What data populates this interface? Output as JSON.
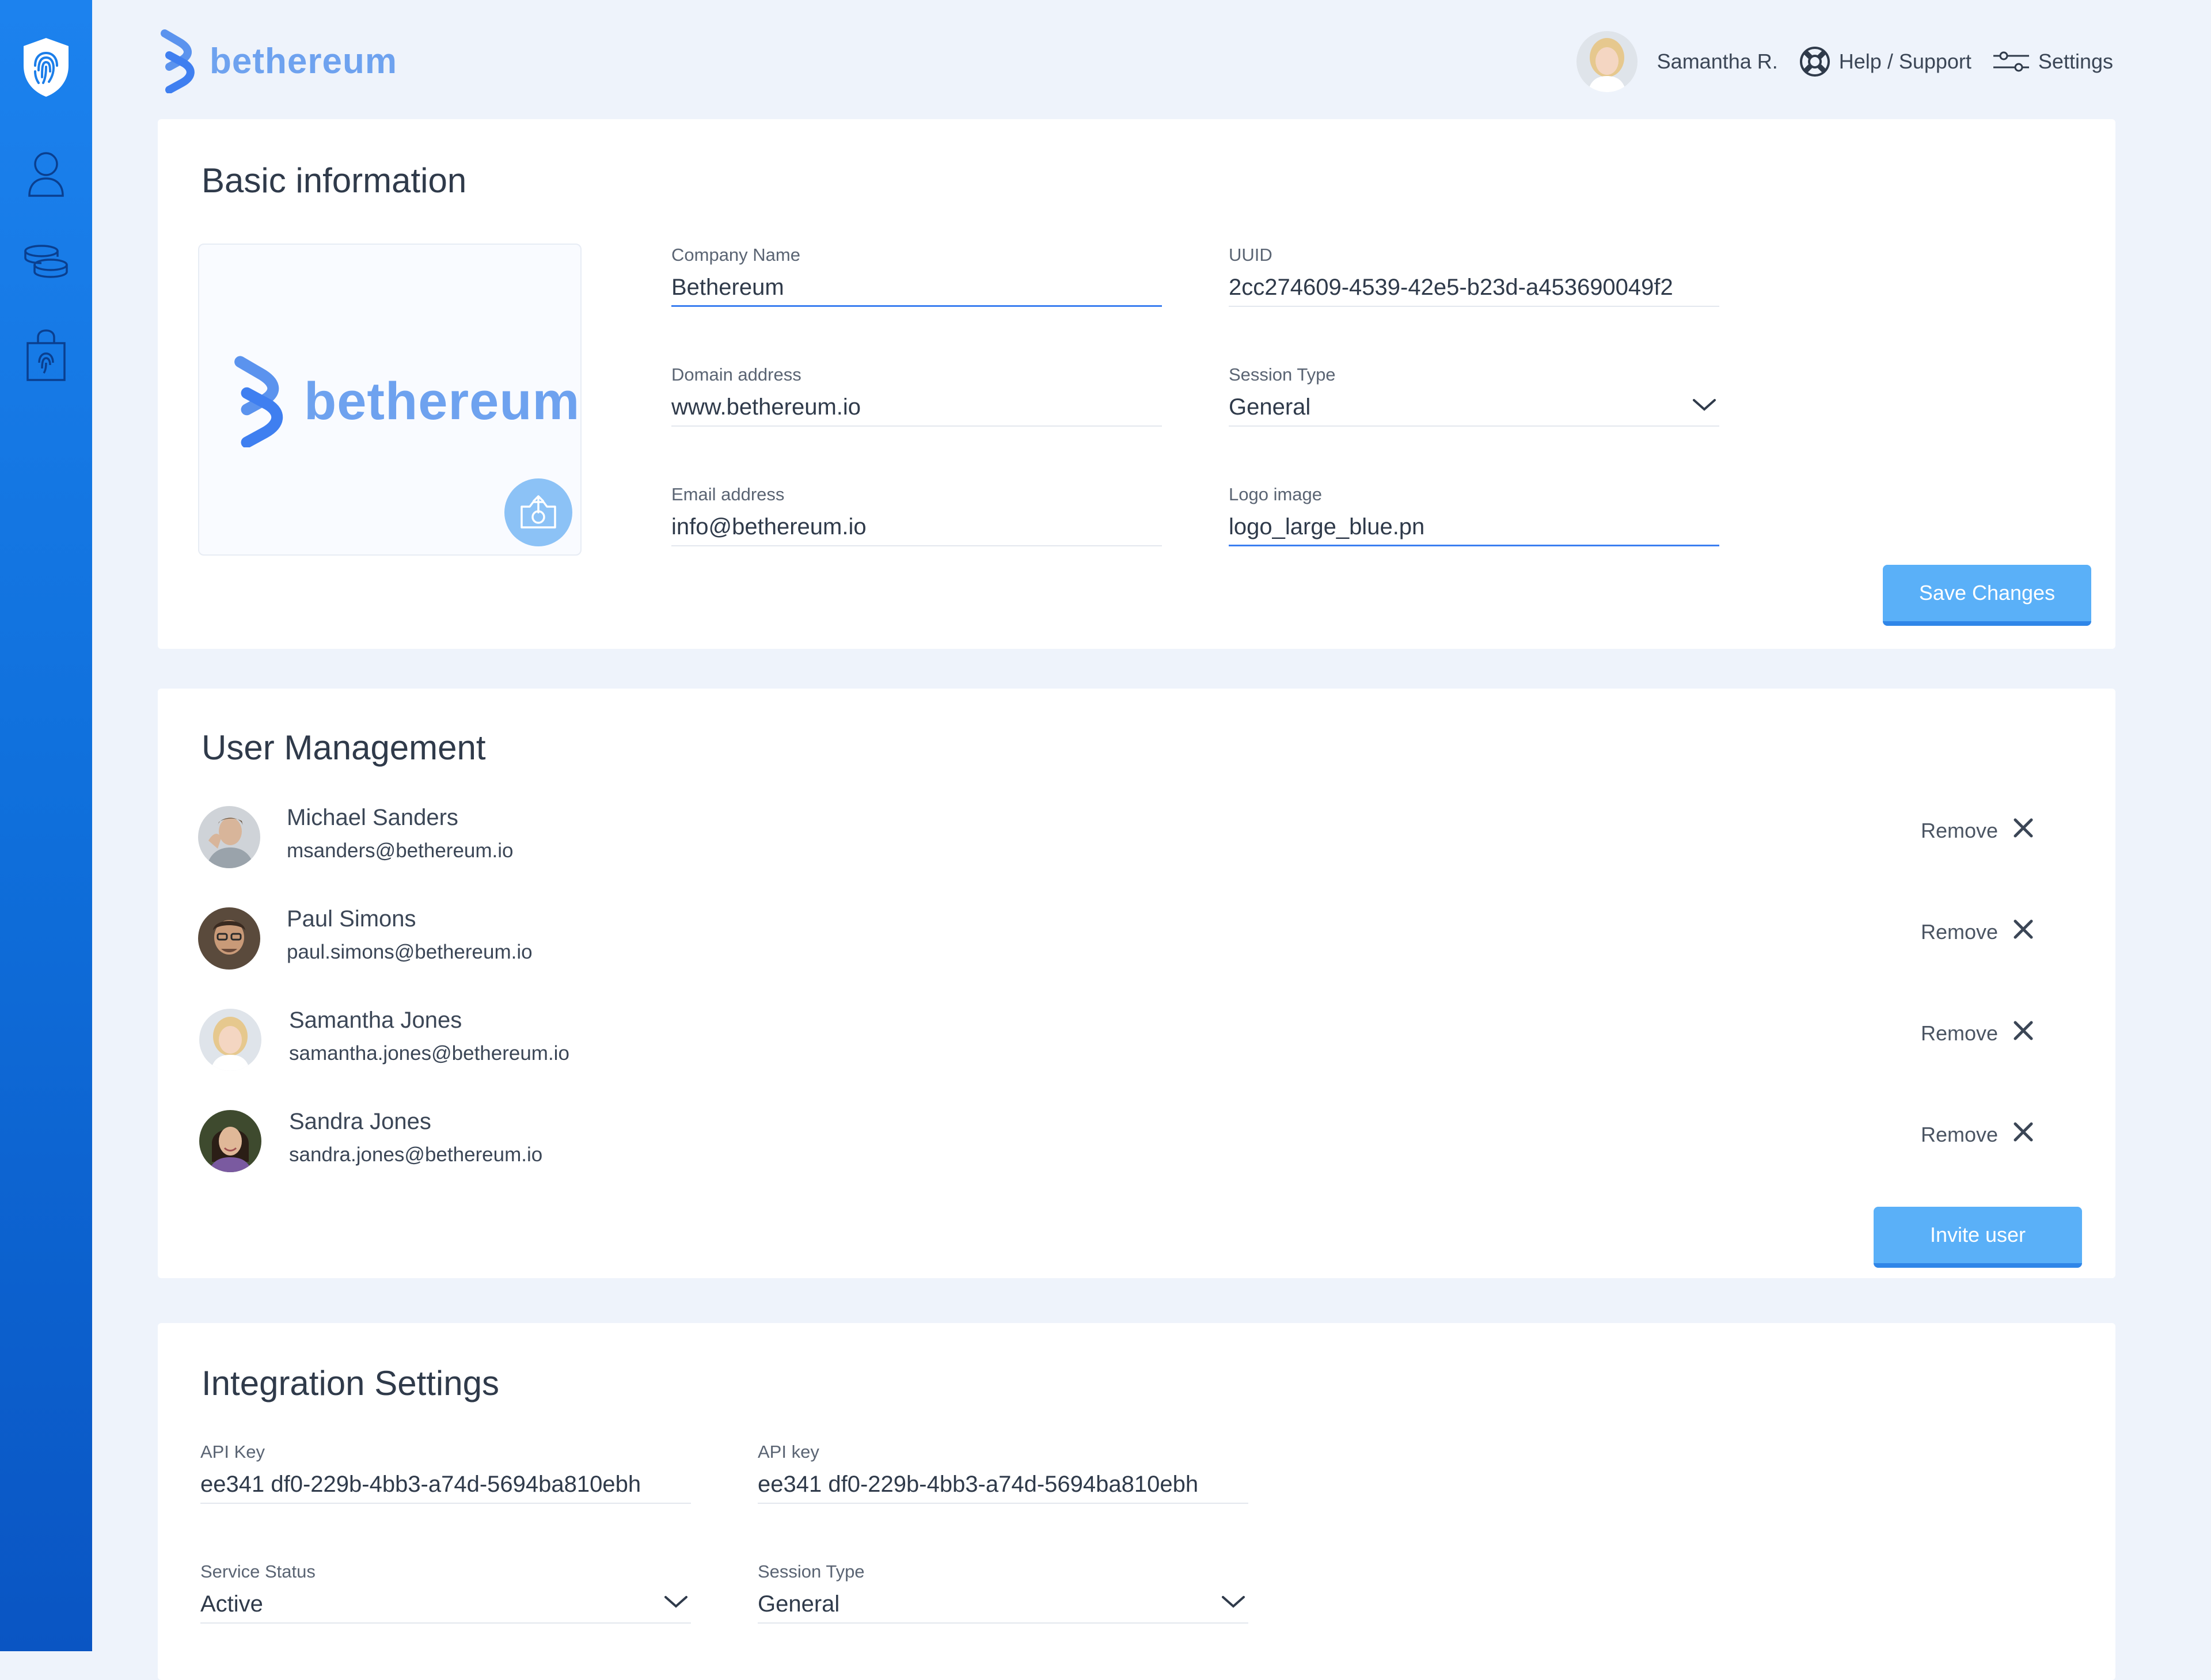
{
  "brand": {
    "name": "bethereum"
  },
  "topbar": {
    "user_name": "Samantha R.",
    "help_label": "Help / Support",
    "settings_label": "Settings"
  },
  "sidebar": {
    "items": [
      {
        "icon": "fingerprint-shield-icon"
      },
      {
        "icon": "user-icon"
      },
      {
        "icon": "coins-icon"
      },
      {
        "icon": "shopping-bag-icon"
      }
    ]
  },
  "basic_info": {
    "title": "Basic information",
    "logo_text": "bethereum",
    "company_name": {
      "label": "Company Name",
      "value": "Bethereum"
    },
    "uuid": {
      "label": "UUID",
      "value": "2cc274609-4539-42e5-b23d-a453690049f2"
    },
    "domain": {
      "label": "Domain address",
      "value": "www.bethereum.io"
    },
    "session_type": {
      "label": "Session Type",
      "value": "General"
    },
    "email": {
      "label": "Email address",
      "value": "info@bethereum.io"
    },
    "logo_image": {
      "label": "Logo image",
      "value": "logo_large_blue.pn"
    },
    "save_label": "Save Changes"
  },
  "user_management": {
    "title": "User Management",
    "remove_label": "Remove",
    "users": [
      {
        "name": "Michael Sanders",
        "email": "msanders@bethereum.io"
      },
      {
        "name": "Paul Simons",
        "email": "paul.simons@bethereum.io"
      },
      {
        "name": "Samantha Jones",
        "email": "samantha.jones@bethereum.io"
      },
      {
        "name": "Sandra Jones",
        "email": "sandra.jones@bethereum.io"
      }
    ],
    "invite_label": "Invite user"
  },
  "integration": {
    "title": "Integration Settings",
    "api_key_1": {
      "label": "API Key",
      "value": "ee341 df0-229b-4bb3-a74d-5694ba810ebh"
    },
    "api_key_2": {
      "label": "API key",
      "value": "ee341 df0-229b-4bb3-a74d-5694ba810ebh"
    },
    "service_status": {
      "label": "Service Status",
      "value": "Active"
    },
    "session_type": {
      "label": "Session Type",
      "value": "General"
    }
  },
  "colors": {
    "sidebar_top": "#1c82ee",
    "sidebar_bottom": "#0a55c3",
    "brand": "#6ea2ef",
    "button": "#5ab0f8",
    "page_bg": "#eef3fb"
  }
}
